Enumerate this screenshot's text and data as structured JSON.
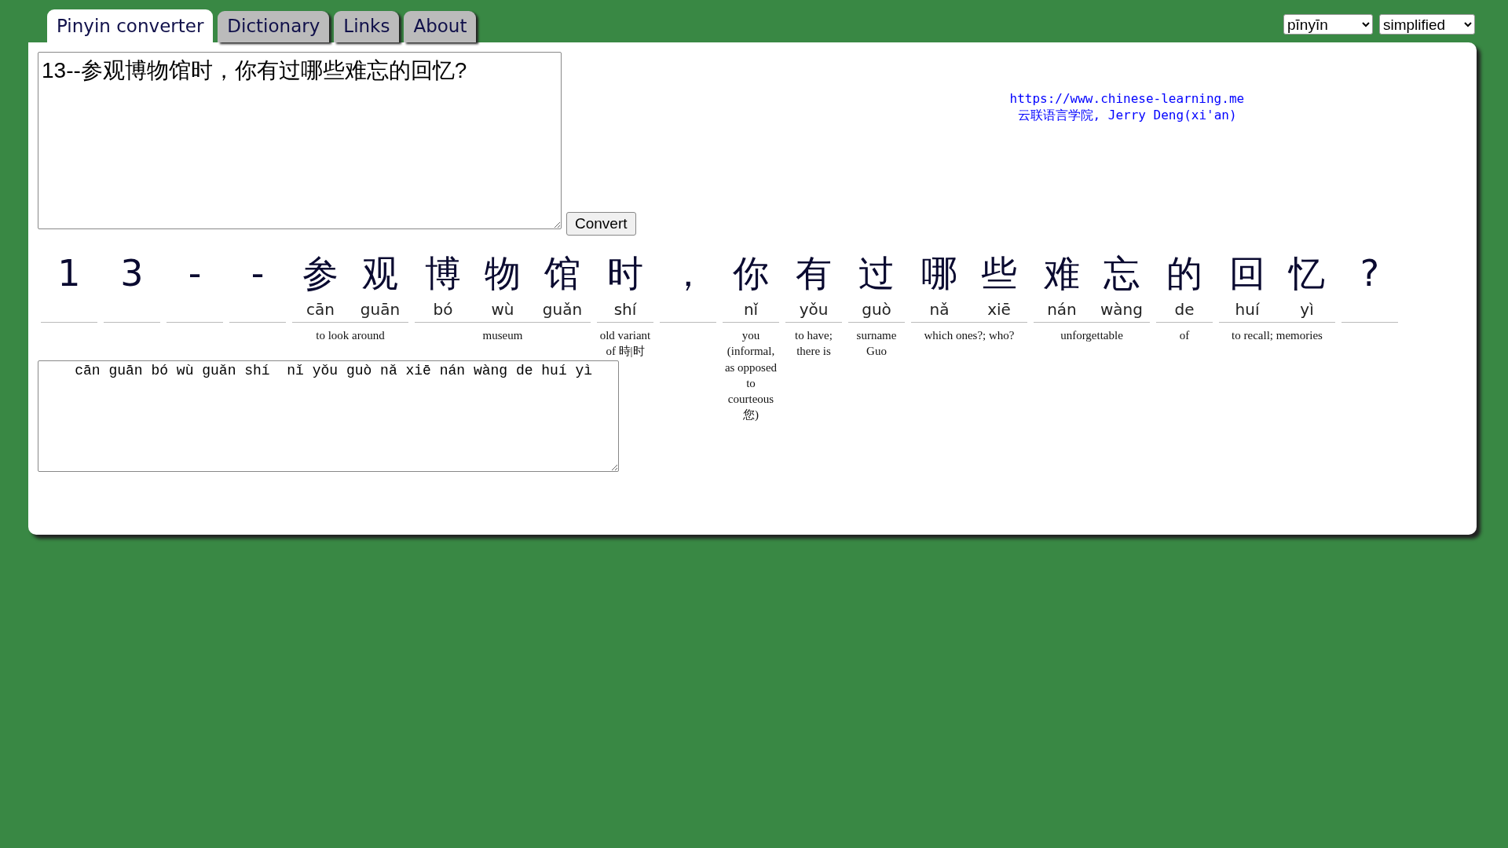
{
  "tabs": [
    {
      "label": "Pinyin converter",
      "selected": true
    },
    {
      "label": "Dictionary",
      "selected": false
    },
    {
      "label": "Links",
      "selected": false
    },
    {
      "label": "About",
      "selected": false
    }
  ],
  "selects": [
    {
      "value": "pīnyīn"
    },
    {
      "value": "simplified"
    }
  ],
  "input": {
    "value": "13--参观博物馆时，你有过哪些难忘的回忆?"
  },
  "convert_button": "Convert",
  "credit": {
    "link": "https://www.chinese-learning.me",
    "line": "云联语言学院, Jerry Deng(xi'an)"
  },
  "words": [
    {
      "chars": [
        {
          "hanzi": "1"
        }
      ]
    },
    {
      "chars": [
        {
          "hanzi": "3"
        }
      ]
    },
    {
      "chars": [
        {
          "hanzi": "-"
        }
      ]
    },
    {
      "chars": [
        {
          "hanzi": "-"
        }
      ]
    },
    {
      "chars": [
        {
          "hanzi": "参",
          "pinyin": "cān"
        },
        {
          "hanzi": "观",
          "pinyin": "guān"
        }
      ],
      "definition": "to look around"
    },
    {
      "chars": [
        {
          "hanzi": "博",
          "pinyin": "bó"
        },
        {
          "hanzi": "物",
          "pinyin": "wù"
        },
        {
          "hanzi": "馆",
          "pinyin": "guǎn"
        }
      ],
      "definition": "museum"
    },
    {
      "chars": [
        {
          "hanzi": "时",
          "pinyin": "shí"
        }
      ],
      "definition": "old variant of 時|时"
    },
    {
      "chars": [
        {
          "hanzi": "，"
        }
      ]
    },
    {
      "chars": [
        {
          "hanzi": "你",
          "pinyin": "nǐ"
        }
      ],
      "definition": "you (informal, as opposed to courteous 您)"
    },
    {
      "chars": [
        {
          "hanzi": "有",
          "pinyin": "yǒu"
        }
      ],
      "definition": "to have; there is"
    },
    {
      "chars": [
        {
          "hanzi": "过",
          "pinyin": "guò"
        }
      ],
      "definition": "surname Guo"
    },
    {
      "chars": [
        {
          "hanzi": "哪",
          "pinyin": "nǎ"
        },
        {
          "hanzi": "些",
          "pinyin": "xiē"
        }
      ],
      "definition": "which ones?; who?"
    },
    {
      "chars": [
        {
          "hanzi": "难",
          "pinyin": "nán"
        },
        {
          "hanzi": "忘",
          "pinyin": "wàng"
        }
      ],
      "definition": "unforgettable"
    },
    {
      "chars": [
        {
          "hanzi": "的",
          "pinyin": "de"
        }
      ],
      "definition": "of"
    },
    {
      "chars": [
        {
          "hanzi": "回",
          "pinyin": "huí"
        },
        {
          "hanzi": "忆",
          "pinyin": "yì"
        }
      ],
      "definition": "to recall; memories"
    },
    {
      "chars": [
        {
          "hanzi": "?"
        }
      ]
    }
  ],
  "output": {
    "value": "    cān guān bó wù guǎn shí  nǐ yǒu guò nǎ xiē nán wàng de huí yì"
  }
}
